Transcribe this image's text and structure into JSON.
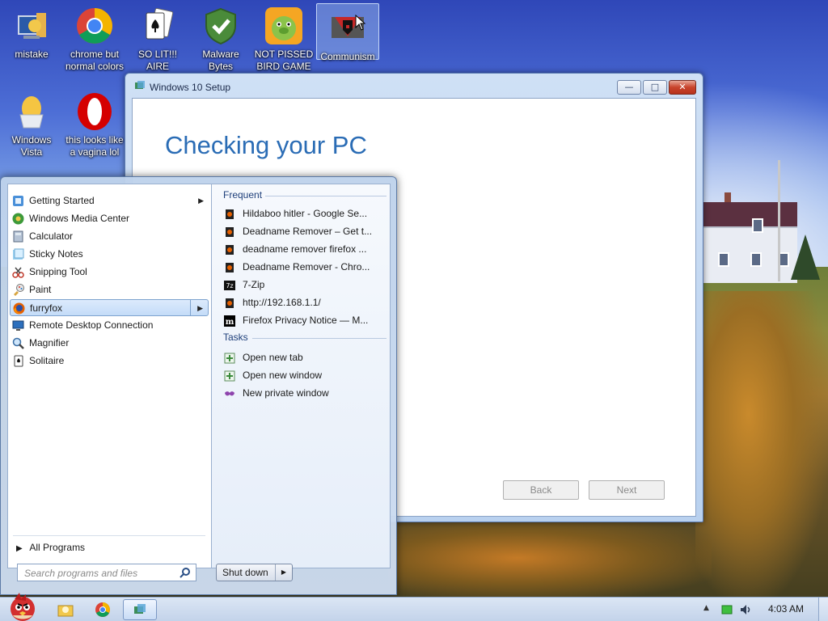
{
  "desktop": {
    "icons": [
      {
        "label_line1": "mistake",
        "label_line2": ""
      },
      {
        "label_line1": "chrome but",
        "label_line2": "normal colors"
      },
      {
        "label_line1": "SO LIT!!! AIRE",
        "label_line2": ""
      },
      {
        "label_line1": "Malware",
        "label_line2": "Bytes"
      },
      {
        "label_line1": "NOT PISSED",
        "label_line2": "BIRD GAME"
      },
      {
        "label_line1": "Communism",
        "label_line2": ""
      },
      {
        "label_line1": "Windows",
        "label_line2": "Vista"
      },
      {
        "label_line1": "this looks like",
        "label_line2": "a vagina lol"
      }
    ]
  },
  "setup_window": {
    "title": "Windows 10 Setup",
    "heading": "Checking your PC",
    "back_label": "Back",
    "next_label": "Next",
    "minimize": "—",
    "maximize": "□",
    "close": "✕"
  },
  "start_menu": {
    "programs": [
      {
        "label": "Getting Started",
        "icon": "getting-started-icon",
        "has_arrow": true
      },
      {
        "label": "Windows Media Center",
        "icon": "media-center-icon",
        "has_arrow": false
      },
      {
        "label": "Calculator",
        "icon": "calculator-icon",
        "has_arrow": false
      },
      {
        "label": "Sticky Notes",
        "icon": "sticky-notes-icon",
        "has_arrow": false
      },
      {
        "label": "Snipping Tool",
        "icon": "snipping-tool-icon",
        "has_arrow": false
      },
      {
        "label": "Paint",
        "icon": "paint-icon",
        "has_arrow": false
      },
      {
        "label": "furryfox",
        "icon": "firefox-icon",
        "has_arrow": true,
        "selected": true
      },
      {
        "label": "Remote Desktop Connection",
        "icon": "remote-desktop-icon",
        "has_arrow": false
      },
      {
        "label": "Magnifier",
        "icon": "magnifier-icon",
        "has_arrow": false
      },
      {
        "label": "Solitaire",
        "icon": "solitaire-icon",
        "has_arrow": false
      }
    ],
    "all_programs": "All Programs",
    "frequent_header": "Frequent",
    "frequent": [
      {
        "label": "Hildaboo hitler - Google Se...",
        "icon": "page-icon"
      },
      {
        "label": "Deadname Remover – Get t...",
        "icon": "page-icon"
      },
      {
        "label": "deadname remover firefox ...",
        "icon": "page-icon"
      },
      {
        "label": "Deadname Remover - Chro...",
        "icon": "page-icon"
      },
      {
        "label": "7-Zip",
        "icon": "7zip-icon"
      },
      {
        "label": "http://192.168.1.1/",
        "icon": "page-icon"
      },
      {
        "label": "Firefox Privacy Notice — M...",
        "icon": "mozilla-icon"
      }
    ],
    "tasks_header": "Tasks",
    "tasks": [
      {
        "label": "Open new tab",
        "icon": "new-tab-icon"
      },
      {
        "label": "Open new window",
        "icon": "new-window-icon"
      },
      {
        "label": "New private window",
        "icon": "private-window-icon"
      }
    ],
    "search_placeholder": "Search programs and files",
    "shutdown_label": "Shut down"
  },
  "taskbar": {
    "clock": "4:03 AM"
  },
  "colors": {
    "accent_blue": "#2a6cb5",
    "selection": "#c4dcf8"
  }
}
